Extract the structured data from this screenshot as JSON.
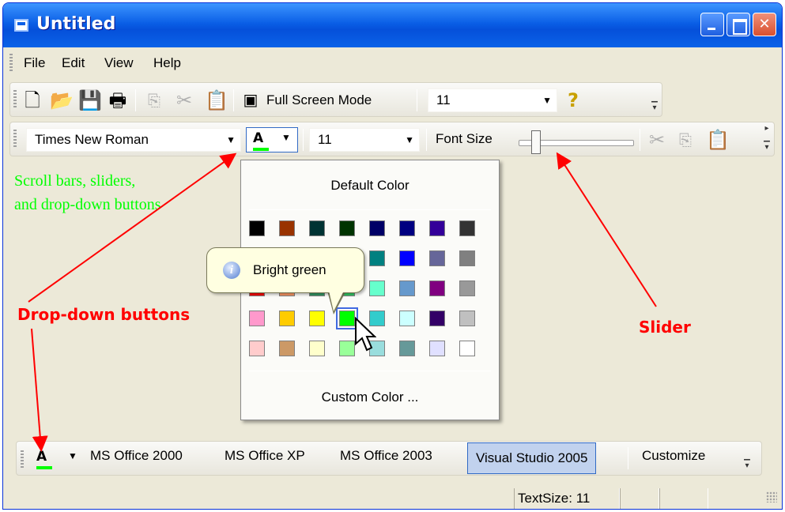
{
  "window": {
    "title": "Untitled"
  },
  "menu": {
    "items": [
      "File",
      "Edit",
      "View",
      "Help"
    ]
  },
  "toolbar1": {
    "full_screen_label": "Full Screen Mode",
    "zoom_value": "11"
  },
  "toolbar2": {
    "font_name": "Times New Roman",
    "font_color_letter": "A",
    "font_size_value": "11",
    "font_size_label": "Font Size"
  },
  "color_popup": {
    "default_label": "Default Color",
    "custom_label": "Custom Color ...",
    "tooltip": "Bright green",
    "selected_color": "#00ff00",
    "rows": [
      [
        "#000000",
        "#993300",
        "#003333",
        "#003300",
        "#000066",
        "#000080",
        "#330099",
        "#333333"
      ],
      [
        "#800000",
        "#ff6600",
        "#808000",
        "#008000",
        "#008080",
        "#0000ff",
        "#666699",
        "#808080"
      ],
      [
        "#ff0000",
        "#ff9966",
        "#339966",
        "#33cc66",
        "#66ffcc",
        "#6699cc",
        "#800080",
        "#999999"
      ],
      [
        "#ff99cc",
        "#ffcc00",
        "#ffff00",
        "#00ff00",
        "#33cccc",
        "#ccffff",
        "#330066",
        "#c0c0c0"
      ],
      [
        "#ffcccc",
        "#cc9966",
        "#ffffcc",
        "#99ff99",
        "#99dddd",
        "#669999",
        "#e0e0ff",
        "#ffffff"
      ]
    ]
  },
  "annotations": {
    "green_note_line1": "Scroll bars, sliders,",
    "green_note_line2": "and drop-down buttons",
    "dropdown_callout": "Drop-down buttons",
    "slider_callout": "Slider"
  },
  "bottom_toolbar": {
    "color_letter": "A",
    "themes": [
      "MS Office 2000",
      "MS Office XP",
      "MS Office 2003",
      "Visual Studio 2005"
    ],
    "active_theme": "Visual Studio 2005",
    "customize": "Customize"
  },
  "status": {
    "text_size": "TextSize: 11"
  }
}
